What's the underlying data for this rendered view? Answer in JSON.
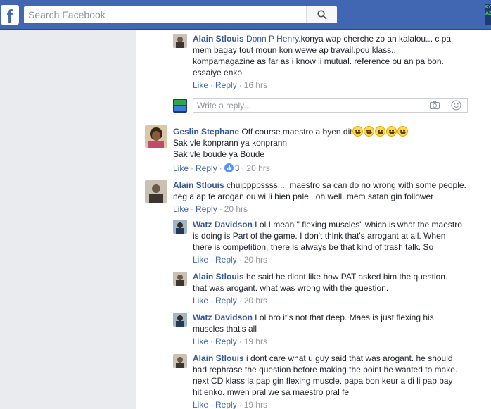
{
  "search": {
    "placeholder": "Search Facebook"
  },
  "corner": {
    "text": "KO\nAZ"
  },
  "comments": [
    {
      "author": "Alain Stlouis",
      "mention": "Donn P Henry",
      "text_lines": [
        ".konya wap cherche zo an kalalou... c pa",
        "mem bagay tout moun kon wewe ap travail.pou klass..",
        "kompamagazine as far as i know li mutual. reference ou an pa bon.",
        "essaiye enko"
      ],
      "like": "Like",
      "reply": "Reply",
      "time": "16 hrs"
    },
    {
      "author": "Geslin Stephane",
      "text_lines": [
        "Off course maestro a byen dit",
        "Sak vle konprann ya konprann",
        "Sak vle boude ya Boude"
      ],
      "like": "Like",
      "reply": "Reply",
      "reactions": "3",
      "time": "20 hrs"
    },
    {
      "author": "Alain Stlouis",
      "text_lines": [
        "chuippppssss.... maestro sa can do no wrong with some people.",
        "neg a ap fe arogan ou wi li bien pale.. oh well. mem satan gin follower"
      ],
      "like": "Like",
      "reply": "Reply",
      "time": "20 hrs"
    },
    {
      "author": "Watz Davidson",
      "text_lines": [
        "Lol I mean \" flexing muscles\" which is what the maestro",
        "is doing is Part of the game. I don't think that's arrogant at all. When",
        "there is competition, there is always be that kind of trash talk. So"
      ],
      "like": "Like",
      "reply": "Reply",
      "time": "20 hrs"
    },
    {
      "author": "Alain Stlouis",
      "text_lines": [
        "he said he didnt like how PAT asked him the question.",
        "that was arogant. what was wrong with the question."
      ],
      "like": "Like",
      "reply": "Reply",
      "time": "20 hrs"
    },
    {
      "author": "Watz Davidson",
      "text_lines": [
        "Lol bro it's not that deep. Maes is just flexing his",
        "muscles that's all"
      ],
      "like": "Like",
      "reply": "Reply",
      "time": "19 hrs"
    },
    {
      "author": "Alain Stlouis",
      "text_lines": [
        "i dont care what u guy said that was arogant. he should",
        "had rephrase the question before making the point he wanted to make.",
        "next CD klass la pap gin flexing muscle. papa bon keur a di li pap bay",
        "hit enko. mwen pral we sa maestro pral fe"
      ],
      "like": "Like",
      "reply": "Reply",
      "time": "19 hrs"
    }
  ],
  "reply_box": {
    "placeholder": "Write a reply...",
    "avatar_text": "KOMPA\nAZINE"
  },
  "colors": {
    "brand": "#4267b2",
    "link": "#365899",
    "meta": "#90949c"
  }
}
